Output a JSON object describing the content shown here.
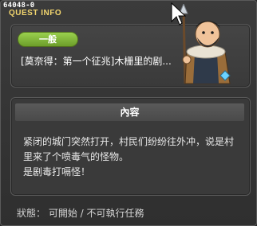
{
  "window": {
    "id": "64048-0",
    "title": "QUEST INFO"
  },
  "quest": {
    "category": "一般",
    "name": "[莫奈得：第一个征兆]木栅里的剧..."
  },
  "content": {
    "header": "內容",
    "lines": [
      "紧闭的城门突然打开，村民们纷纷往外冲，说是村",
      "里来了个喷毒气的怪物。",
      "是剧毒打嗝怪！"
    ]
  },
  "status": {
    "text": "狀態： 可開始 / 不可執行任務"
  },
  "icons": {
    "character": "bearded-warrior-npc-icon",
    "cursor": "mouse-pointer-icon"
  },
  "colors": {
    "accent_title": "#f3d66e",
    "category_pill": "#8cc443"
  }
}
